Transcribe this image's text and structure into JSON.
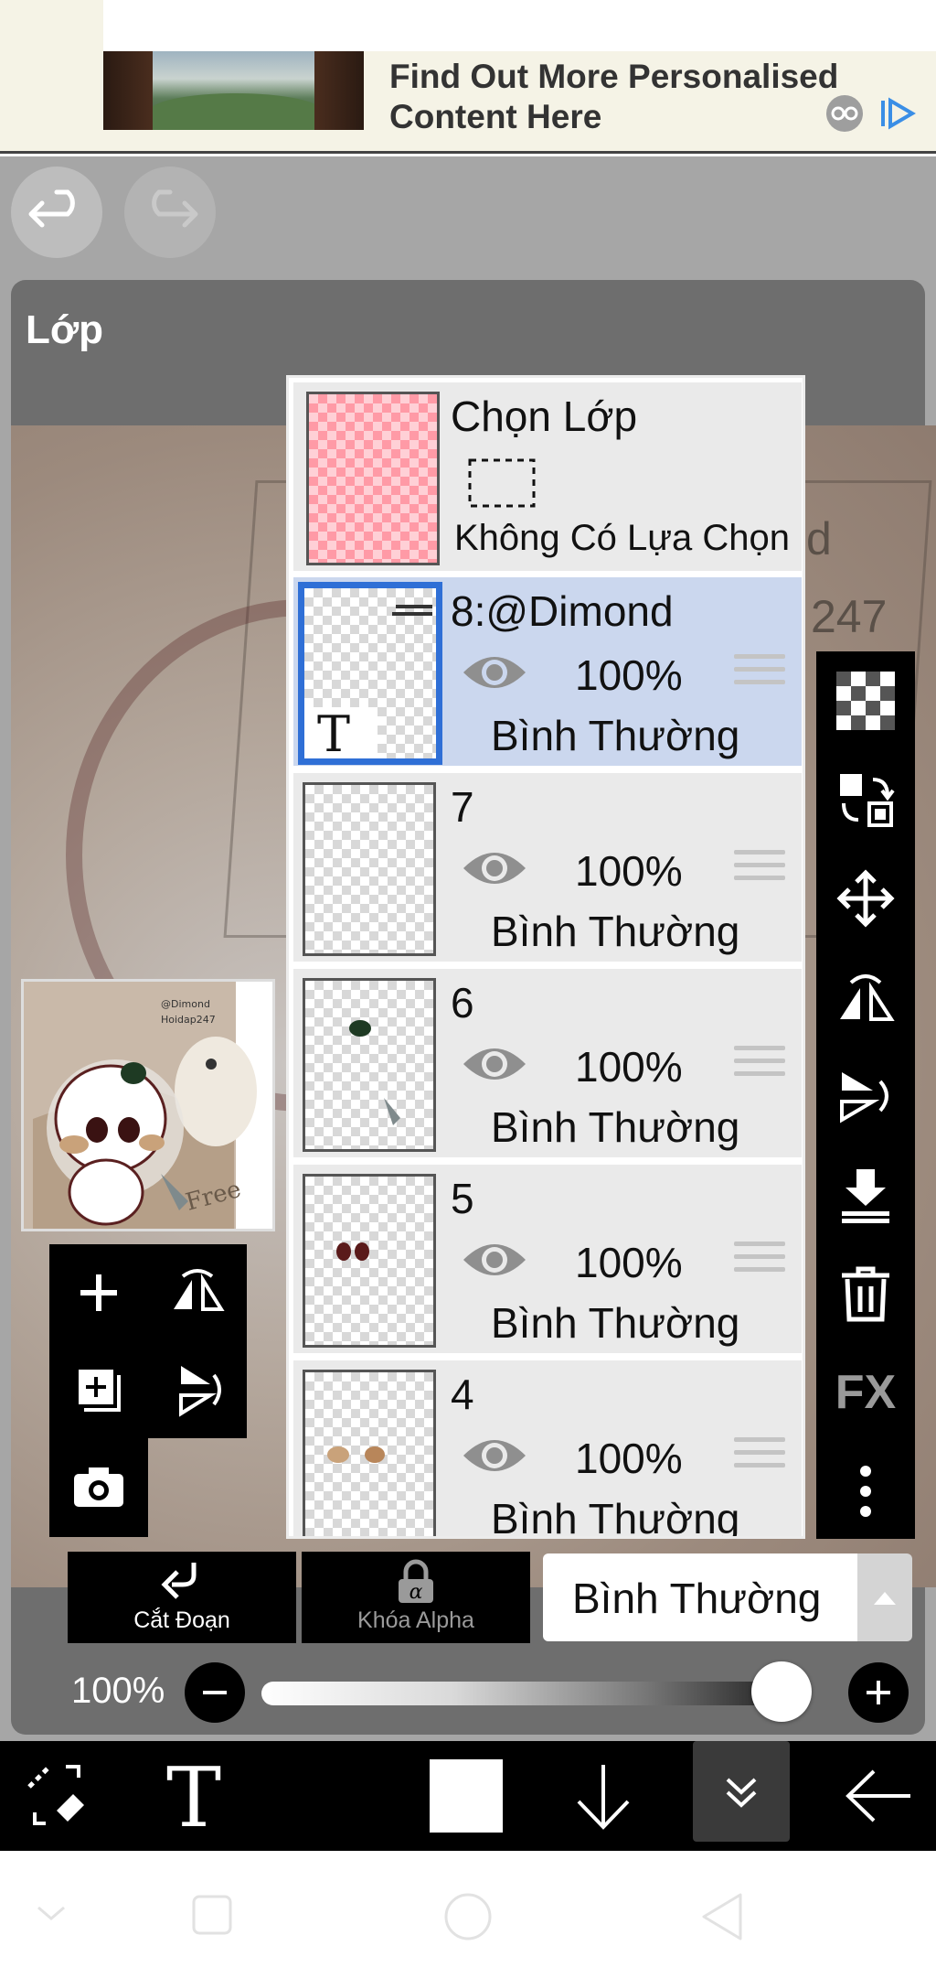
{
  "ad": {
    "headline_line1": "Find Out More Personalised",
    "headline_line2": "Content Here"
  },
  "toolbar_top": {
    "undo_icon": "undo-icon",
    "redo_icon": "redo-icon"
  },
  "panel": {
    "title": "Lớp"
  },
  "selection_layer": {
    "title": "Chọn Lớp",
    "subtitle": "Không Có Lựa Chọn"
  },
  "layers": [
    {
      "name": "8:@Dimond",
      "opacity": "100%",
      "blend": "Bình Thường",
      "selected": true
    },
    {
      "name": "7",
      "opacity": "100%",
      "blend": "Bình Thường",
      "selected": false
    },
    {
      "name": "6",
      "opacity": "100%",
      "blend": "Bình Thường",
      "selected": false
    },
    {
      "name": "5",
      "opacity": "100%",
      "blend": "Bình Thường",
      "selected": false
    },
    {
      "name": "4",
      "opacity": "100%",
      "blend": "Bình Thường",
      "selected": false
    }
  ],
  "layer8_thumb_text": "T",
  "thumbnail": {
    "text1": "@Dimond",
    "text2": "Hoidap247",
    "text3": "Free"
  },
  "canvas_text": {
    "partial1": "d",
    "partial2": "247"
  },
  "right_toolbar": {
    "fx_label": "FX"
  },
  "bottom_controls": {
    "cut_label": "Cắt Đoạn",
    "alpha_label": "Khóa Alpha",
    "blend_mode": "Bình Thường"
  },
  "opacity": {
    "label": "100%",
    "value": 1.0
  },
  "colors": {
    "selected_layer_bg": "#cbd7ee",
    "selected_border": "#2f6fd6",
    "panel_bg": "#6e6e6e",
    "app_bg": "#a6a6a6"
  }
}
